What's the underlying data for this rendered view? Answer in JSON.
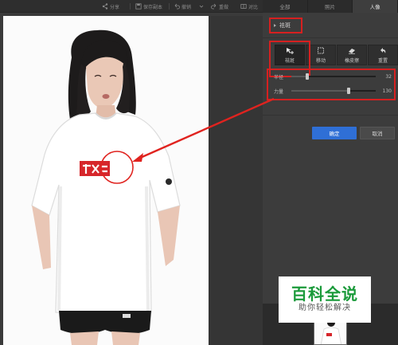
{
  "toolbar": {
    "share_label": "分享",
    "save_as_label": "保存副本",
    "undo_label": "撤销",
    "redo_label": "重做",
    "compare_label": "对比"
  },
  "tabs": [
    "全部",
    "照片",
    "人像"
  ],
  "panel": {
    "section_title": "祛斑",
    "tools": [
      {
        "label": "祛斑",
        "icon": "spot-brush-icon"
      },
      {
        "label": "移动",
        "icon": "move-frame-icon"
      },
      {
        "label": "橡皮擦",
        "icon": "eraser-icon"
      },
      {
        "label": "重置",
        "icon": "reset-arrow-icon"
      }
    ],
    "sliders": [
      {
        "label": "半径",
        "value": "32",
        "level": 0.18
      },
      {
        "label": "力量",
        "value": "130",
        "level": 0.67
      }
    ],
    "confirm_label": "确定",
    "cancel_label": "取消"
  },
  "watermark": {
    "title": "百科全说",
    "subtitle": "助你轻松解决"
  },
  "colors": {
    "highlight": "#d62020",
    "confirm": "#2f6fd6",
    "watermark_green": "#1a9a3a"
  }
}
